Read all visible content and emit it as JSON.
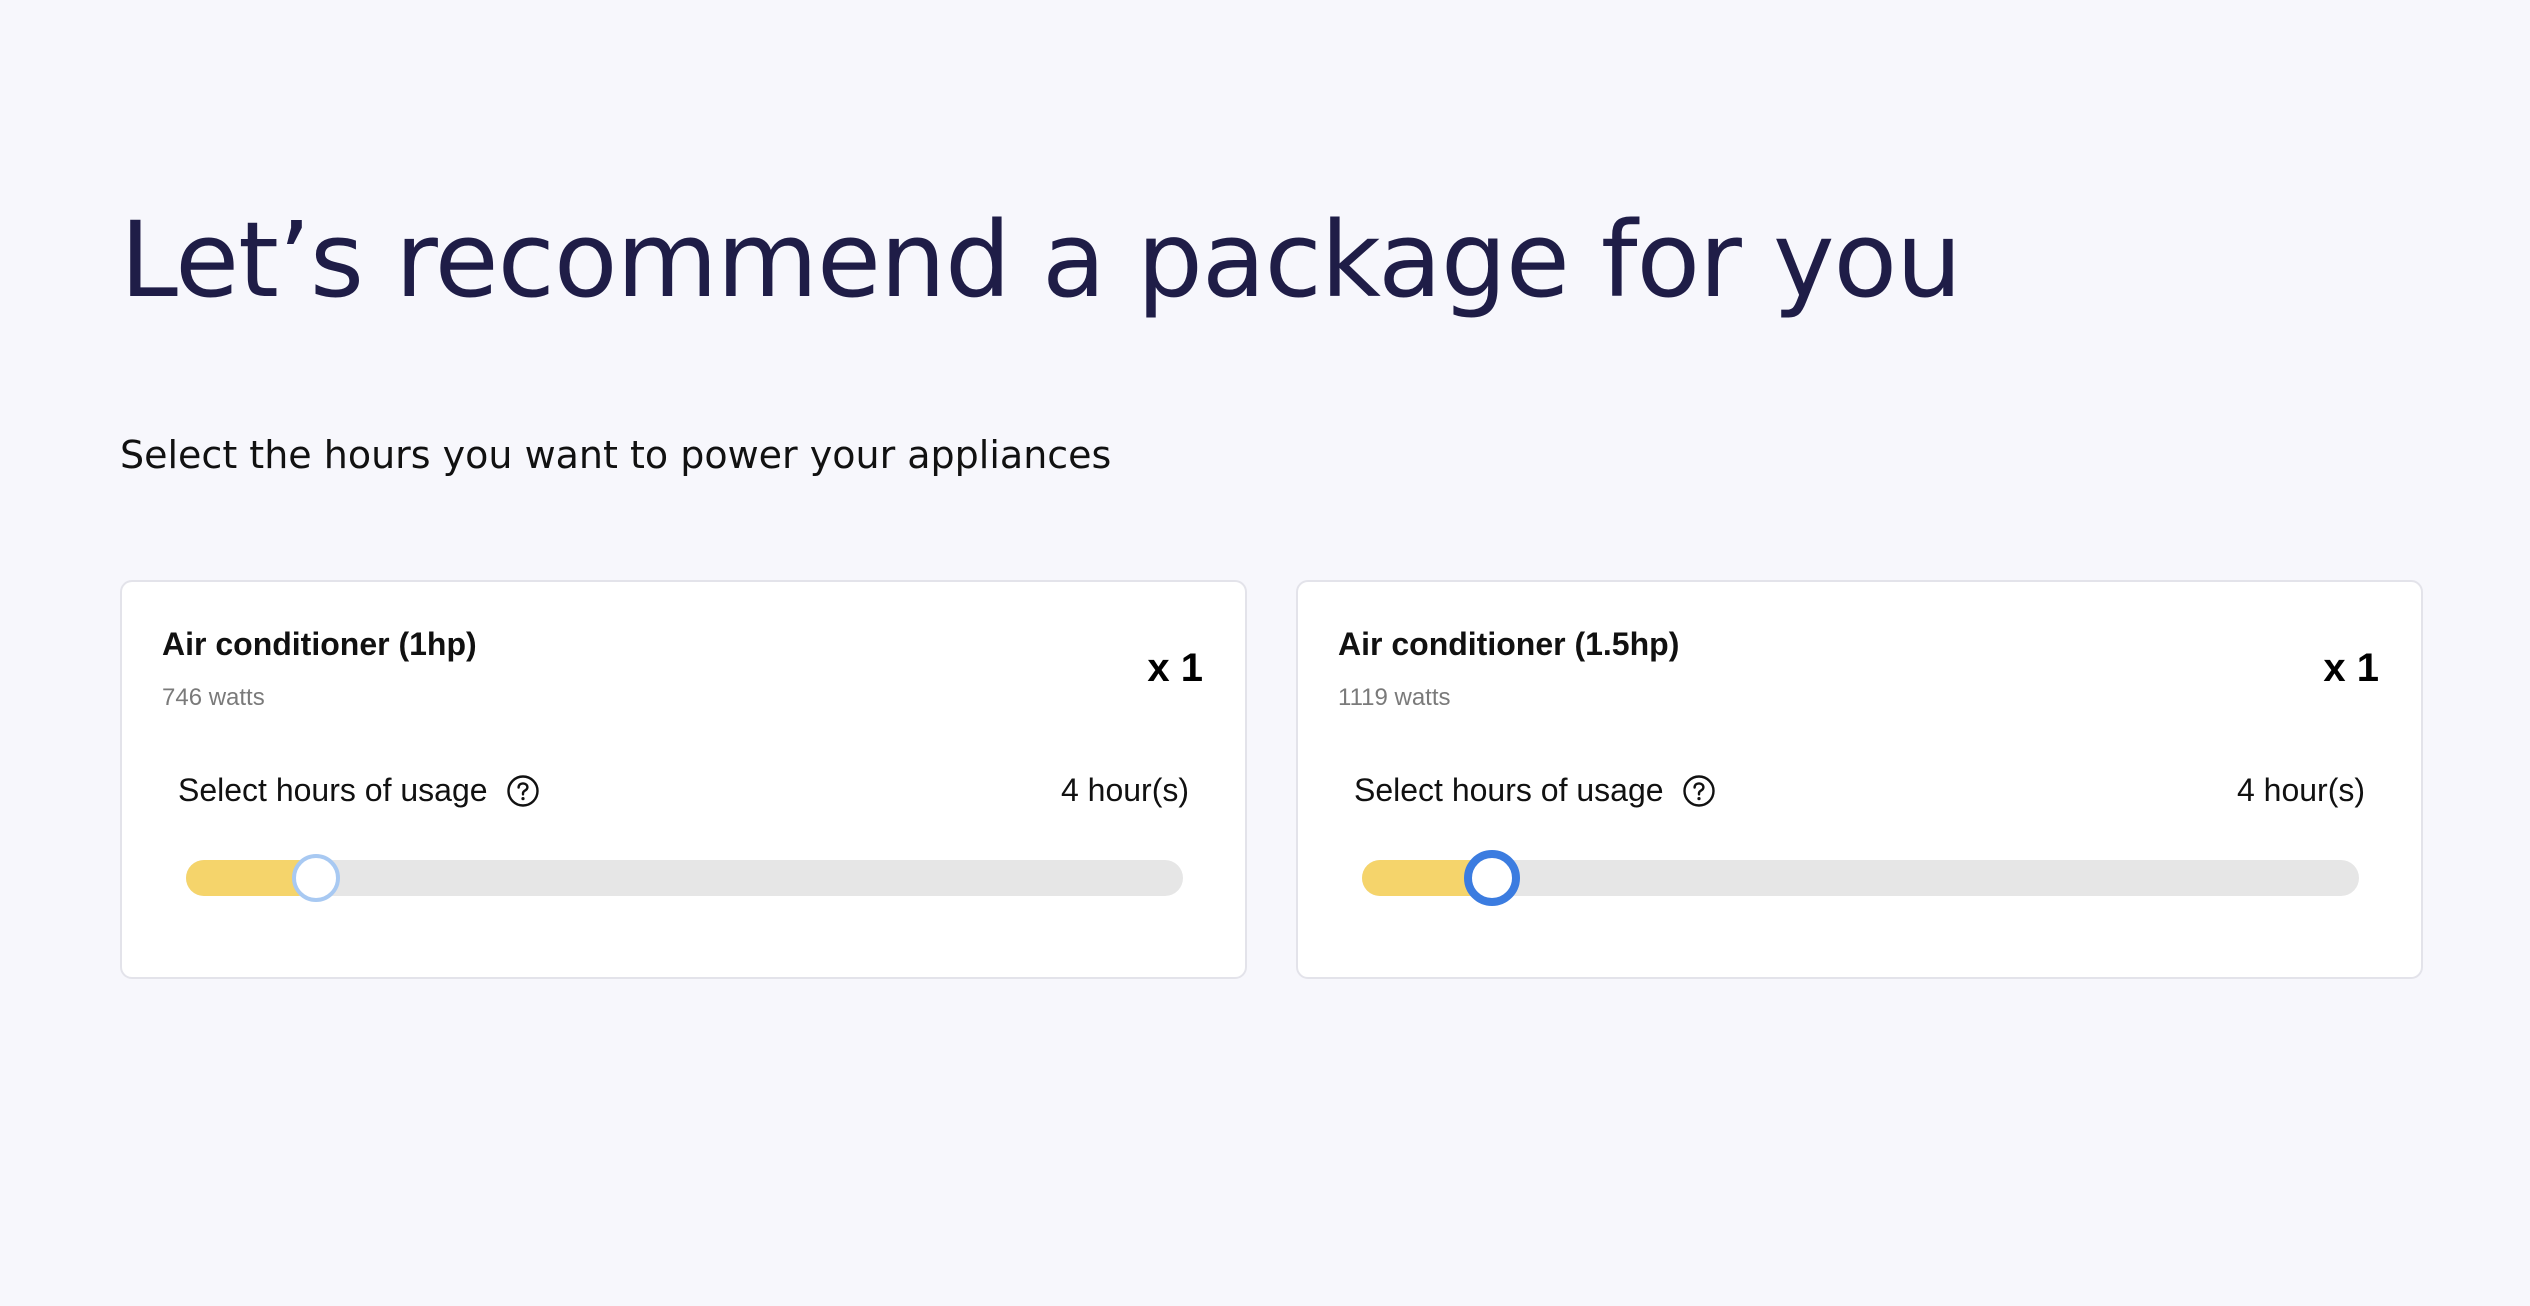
{
  "page": {
    "title": "Let’s recommend a package for you",
    "subtitle": "Select the hours you want to power your appliances"
  },
  "appliances": [
    {
      "name": "Air conditioner (1hp)",
      "watts": "746 watts",
      "quantity": "x 1",
      "usage_label": "Select hours of usage",
      "hours_display": "4 hour(s)",
      "slider_fraction": 0.13,
      "thumb_state": "idle"
    },
    {
      "name": "Air conditioner (1.5hp)",
      "watts": "1119 watts",
      "quantity": "x 1",
      "usage_label": "Select hours of usage",
      "hours_display": "4 hour(s)",
      "slider_fraction": 0.13,
      "thumb_state": "focused"
    }
  ],
  "colors": {
    "title": "#1f1d47",
    "slider_fill": "#f5d46b",
    "slider_track": "#e6e6e6",
    "thumb_focus_ring": "#3b7ce0",
    "thumb_idle_ring": "#a8c9f2"
  },
  "icons": {
    "help": "question-circle-icon"
  }
}
